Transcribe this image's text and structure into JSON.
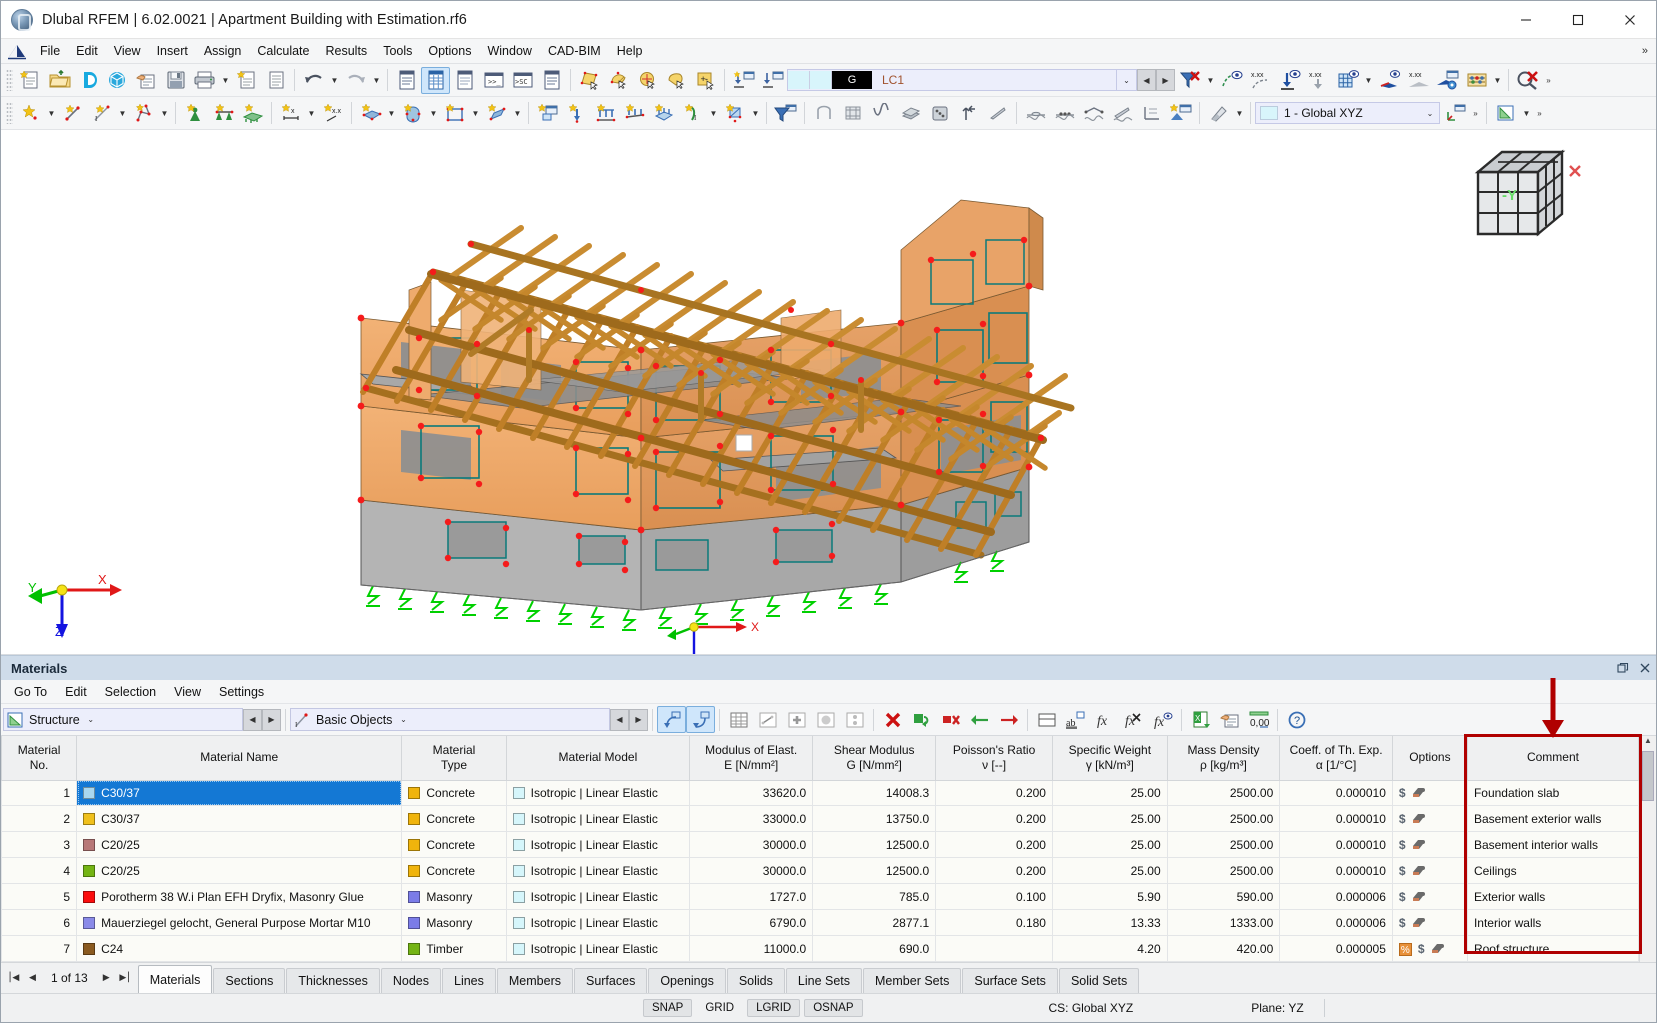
{
  "window": {
    "title": "Dlubal RFEM | 6.02.0021 | Apartment Building with Estimation.rf6",
    "logo_name": "dlubal-rfem-logo",
    "minimize": "–",
    "maximize": "□",
    "close": "✕"
  },
  "menubar": {
    "items": [
      {
        "label": "File"
      },
      {
        "label": "Edit"
      },
      {
        "label": "View"
      },
      {
        "label": "Insert"
      },
      {
        "label": "Assign"
      },
      {
        "label": "Calculate"
      },
      {
        "label": "Results"
      },
      {
        "label": "Tools"
      },
      {
        "label": "Options"
      },
      {
        "label": "Window"
      },
      {
        "label": "CAD-BIM"
      },
      {
        "label": "Help"
      }
    ],
    "overflow": "»"
  },
  "toolbar1": {
    "groups": [
      {
        "buttons": [
          {
            "name": "new-model-icon",
            "glyph": "doc-star"
          },
          {
            "name": "open-folder-icon",
            "glyph": "folder"
          },
          {
            "name": "dlubal-center-icon",
            "glyph": "d-blue"
          },
          {
            "name": "model-cloud-icon",
            "glyph": "cube-blue"
          },
          {
            "name": "model-info-icon",
            "glyph": "hand-doc"
          },
          {
            "name": "save-icon",
            "glyph": "save"
          },
          {
            "name": "print-icon",
            "glyph": "print",
            "caret": true
          },
          {
            "name": "printout-report-icon",
            "glyph": "doc-star"
          },
          {
            "name": "new-report-icon",
            "glyph": "doc"
          }
        ]
      },
      {
        "buttons": [
          {
            "name": "undo-icon",
            "glyph": "undo",
            "caret": true
          },
          {
            "name": "redo-icon",
            "glyph": "redo",
            "caret": true
          }
        ]
      },
      {
        "buttons": [
          {
            "name": "navigator-icon",
            "glyph": "list-panel"
          },
          {
            "name": "table-panel-icon",
            "glyph": "grid-tbl",
            "active": true
          },
          {
            "name": "data-panel-icon",
            "glyph": "list-panel2"
          },
          {
            "name": "console-icon",
            "glyph": "console"
          },
          {
            "name": "script-console-icon",
            "glyph": "console2"
          },
          {
            "name": "detail-panel-icon",
            "glyph": "list-panel"
          }
        ]
      },
      {
        "buttons": [
          {
            "name": "select-by-rectangle-icon",
            "glyph": "sel-rect"
          },
          {
            "name": "select-special-icon",
            "glyph": "sel-special"
          },
          {
            "name": "select-circle-icon",
            "glyph": "sel-circle"
          },
          {
            "name": "select-polygon-icon",
            "glyph": "sel-poly"
          },
          {
            "name": "select-invert-icon",
            "glyph": "sel-invert"
          }
        ]
      },
      {
        "buttons": [
          {
            "name": "load-case-show-icon",
            "glyph": "lc-show"
          },
          {
            "name": "load-case-apply-icon",
            "glyph": "lc-apply"
          }
        ]
      }
    ],
    "load_case": {
      "group_tag": "G",
      "name": "LC1",
      "dropdown_arrow": "⌄",
      "prev": "◀",
      "next": "▶"
    },
    "right_buttons": [
      {
        "name": "filter-clear-icon",
        "glyph": "filter-x",
        "caret": true
      },
      {
        "name": "show-deformation-icon",
        "glyph": "deform-eye"
      },
      {
        "name": "deformation-value-icon",
        "glyph": "xxx-deform"
      },
      {
        "name": "show-supports-icon",
        "glyph": "support-eye"
      },
      {
        "name": "support-value-icon",
        "glyph": "xxx-support"
      },
      {
        "name": "show-grid-icon",
        "glyph": "grid-eye",
        "caret": true
      },
      {
        "name": "show-diagram-icon",
        "glyph": "diagram-eye"
      },
      {
        "name": "diagram-value-icon",
        "glyph": "xxx-diagram"
      },
      {
        "name": "result-settings-icon",
        "glyph": "diagram-gear"
      },
      {
        "name": "calculation-icon",
        "glyph": "abacus",
        "caret": true
      }
    ],
    "far_right": [
      {
        "name": "clear-results-icon",
        "glyph": "magnifier-x"
      }
    ],
    "overflow": "»"
  },
  "toolbar2": {
    "groups": [
      {
        "buttons": [
          {
            "name": "new-node-icon",
            "glyph": "star-node",
            "caret": true
          },
          {
            "name": "new-line-icon",
            "glyph": "star-line"
          },
          {
            "name": "new-line-dim-icon",
            "glyph": "star-line2",
            "caret": true
          },
          {
            "name": "new-polyline-icon",
            "glyph": "star-poly",
            "caret": true
          }
        ]
      },
      {
        "buttons": [
          {
            "name": "new-support-icon",
            "glyph": "star-support"
          },
          {
            "name": "new-line-support-icon",
            "glyph": "star-lsupport"
          },
          {
            "name": "new-surface-support-icon",
            "glyph": "star-ssupport"
          }
        ]
      },
      {
        "buttons": [
          {
            "name": "new-dimension-x-icon",
            "glyph": "star-dimx",
            "caret": true
          },
          {
            "name": "new-dimension-xx-icon",
            "glyph": "star-dimxx"
          }
        ]
      },
      {
        "buttons": [
          {
            "name": "new-surface-icon",
            "glyph": "star-surface",
            "caret": true
          },
          {
            "name": "new-solid-icon",
            "glyph": "star-solid",
            "caret": true
          },
          {
            "name": "new-opening-icon",
            "glyph": "star-opening",
            "caret": true
          },
          {
            "name": "new-member-icon",
            "glyph": "star-member",
            "caret": true
          }
        ]
      },
      {
        "buttons": [
          {
            "name": "new-load-icon",
            "glyph": "star-load"
          },
          {
            "name": "new-nodal-load-icon",
            "glyph": "star-nload"
          },
          {
            "name": "new-line-load-icon",
            "glyph": "star-lload"
          },
          {
            "name": "new-member-load-icon",
            "glyph": "star-mload"
          },
          {
            "name": "new-surface-load-icon",
            "glyph": "star-sload"
          },
          {
            "name": "new-free-load-icon",
            "glyph": "star-fload",
            "caret": true
          },
          {
            "name": "new-imperfection-icon",
            "glyph": "star-imp",
            "caret": true
          }
        ]
      },
      {
        "buttons": [
          {
            "name": "visibility-icon",
            "glyph": "funnel-blue"
          }
        ]
      },
      {
        "buttons": [
          {
            "name": "render-wireframe-icon",
            "glyph": "wire"
          },
          {
            "name": "render-filled-icon",
            "glyph": "filmstrip"
          },
          {
            "name": "render-smooth-icon",
            "glyph": "curve"
          },
          {
            "name": "render-surface-icon",
            "glyph": "plate"
          },
          {
            "name": "render-solid-icon",
            "glyph": "dice"
          },
          {
            "name": "render-transparent-icon",
            "glyph": "arrows-up"
          },
          {
            "name": "render-line-icon",
            "glyph": "slash"
          }
        ]
      },
      {
        "buttons": [
          {
            "name": "hinge-display-icon",
            "glyph": "hinge1"
          },
          {
            "name": "hinge-display2-icon",
            "glyph": "hinge2"
          },
          {
            "name": "hinge-display3-icon",
            "glyph": "hinge3"
          },
          {
            "name": "hinge-display4-icon",
            "glyph": "hinge4"
          },
          {
            "name": "hinge-display5-icon",
            "glyph": "hinge5"
          },
          {
            "name": "new-view-icon",
            "glyph": "star-view"
          }
        ]
      },
      {
        "buttons": [
          {
            "name": "work-plane-icon",
            "glyph": "plane-grey",
            "caret": true
          }
        ]
      }
    ],
    "coordinate_system": {
      "value": "1 - Global XYZ",
      "arrow": "⌄"
    },
    "cs_extra": [
      {
        "name": "cs-settings-icon",
        "glyph": "cs-gear"
      }
    ],
    "overflow": "»",
    "right_buttons": [
      {
        "name": "section-properties-icon",
        "glyph": "green-table",
        "caret": true
      }
    ]
  },
  "viewport": {
    "navcube_label": "-Y",
    "axes": {
      "x": "X",
      "y": "Y",
      "z": "Z"
    }
  },
  "panel": {
    "title": "Materials",
    "window_controls": {
      "restore": "❐",
      "close": "✕"
    },
    "menu": [
      {
        "label": "Go To"
      },
      {
        "label": "Edit"
      },
      {
        "label": "Selection"
      },
      {
        "label": "View"
      },
      {
        "label": "Settings"
      }
    ],
    "combo_structure": {
      "value": "Structure",
      "arrow": "⌄",
      "prev": "◀",
      "next": "▶"
    },
    "combo_objects": {
      "value": "Basic Objects",
      "arrow": "⌄",
      "prev": "◀",
      "next": "▶"
    },
    "toolbar_buttons": [
      {
        "name": "select-in-model-icon",
        "glyph": "arrow-up-box",
        "active": true
      },
      {
        "name": "select-in-table-icon",
        "glyph": "arrow-down-box",
        "active": true
      },
      {
        "name": "table-view-all-icon",
        "glyph": "tbl1"
      },
      {
        "name": "table-view-members-icon",
        "glyph": "tbl2"
      },
      {
        "name": "table-view-nodes-icon",
        "glyph": "tbl3"
      },
      {
        "name": "table-view-surfaces-icon",
        "glyph": "tbl4"
      },
      {
        "name": "table-view-solids-icon",
        "glyph": "tbl5"
      },
      {
        "name": "delete-row-icon",
        "glyph": "red-x"
      },
      {
        "name": "insert-row-icon",
        "glyph": "green-insert"
      },
      {
        "name": "delete-content-icon",
        "glyph": "red-delete"
      },
      {
        "name": "move-left-icon",
        "glyph": "green-left"
      },
      {
        "name": "move-right-icon",
        "glyph": "red-right"
      },
      {
        "name": "table-layout-icon",
        "glyph": "tbl-layout"
      },
      {
        "name": "rename-icon",
        "glyph": "ab-equals"
      },
      {
        "name": "formula-icon",
        "glyph": "fx"
      },
      {
        "name": "delete-formula-icon",
        "glyph": "fx-x"
      },
      {
        "name": "show-formula-icon",
        "glyph": "fx-eye"
      },
      {
        "name": "export-excel-icon",
        "glyph": "excel"
      },
      {
        "name": "print-table-icon",
        "glyph": "print-hand"
      },
      {
        "name": "decimal-places-icon",
        "glyph": "zero-comma"
      },
      {
        "name": "table-help-icon",
        "glyph": "question"
      }
    ]
  },
  "table": {
    "columns": [
      {
        "id": "no",
        "header": "Material",
        "subheader": "No."
      },
      {
        "id": "name",
        "header": "Material Name",
        "subheader": ""
      },
      {
        "id": "type",
        "header": "Material",
        "subheader": "Type"
      },
      {
        "id": "model",
        "header": "Material Model",
        "subheader": ""
      },
      {
        "id": "emod",
        "header": "Modulus of Elast.",
        "subheader": "E [N/mm²]"
      },
      {
        "id": "gmod",
        "header": "Shear Modulus",
        "subheader": "G [N/mm²]"
      },
      {
        "id": "poisson",
        "header": "Poisson's Ratio",
        "subheader": "ν [--]"
      },
      {
        "id": "weight",
        "header": "Specific Weight",
        "subheader": "γ [kN/m³]"
      },
      {
        "id": "density",
        "header": "Mass Density",
        "subheader": "ρ [kg/m³]"
      },
      {
        "id": "alpha",
        "header": "Coeff. of Th. Exp.",
        "subheader": "α [1/°C]"
      },
      {
        "id": "options",
        "header": "Options",
        "subheader": ""
      },
      {
        "id": "comment",
        "header": "Comment",
        "subheader": ""
      }
    ],
    "rows": [
      {
        "no": "1",
        "color": "#a9d7ef",
        "name": "C30/37",
        "type_color": "#f0b40c",
        "type": "Concrete",
        "model_color": "#d6f6fb",
        "model": "Isotropic | Linear Elastic",
        "emod": "33620.0",
        "gmod": "14008.3",
        "poisson": "0.200",
        "weight": "25.00",
        "density": "2500.00",
        "alpha": "0.000010",
        "options": [
          "dollar",
          "eraser"
        ],
        "comment": "Foundation slab",
        "selected": true
      },
      {
        "no": "2",
        "color": "#f0c01c",
        "name": "C30/37",
        "type_color": "#f0b40c",
        "type": "Concrete",
        "model_color": "#d6f6fb",
        "model": "Isotropic | Linear Elastic",
        "emod": "33000.0",
        "gmod": "13750.0",
        "poisson": "0.200",
        "weight": "25.00",
        "density": "2500.00",
        "alpha": "0.000010",
        "options": [
          "dollar",
          "eraser"
        ],
        "comment": "Basement exterior walls",
        "selected": false
      },
      {
        "no": "3",
        "color": "#b87878",
        "name": "C20/25",
        "type_color": "#f0b40c",
        "type": "Concrete",
        "model_color": "#d6f6fb",
        "model": "Isotropic | Linear Elastic",
        "emod": "30000.0",
        "gmod": "12500.0",
        "poisson": "0.200",
        "weight": "25.00",
        "density": "2500.00",
        "alpha": "0.000010",
        "options": [
          "dollar",
          "eraser"
        ],
        "comment": "Basement interior walls",
        "selected": false
      },
      {
        "no": "4",
        "color": "#74b414",
        "name": "C20/25",
        "type_color": "#f0b40c",
        "type": "Concrete",
        "model_color": "#d6f6fb",
        "model": "Isotropic | Linear Elastic",
        "emod": "30000.0",
        "gmod": "12500.0",
        "poisson": "0.200",
        "weight": "25.00",
        "density": "2500.00",
        "alpha": "0.000010",
        "options": [
          "dollar",
          "eraser"
        ],
        "comment": "Ceilings",
        "selected": false
      },
      {
        "no": "5",
        "color": "#fb0d0d",
        "name": "Porotherm 38 W.i Plan EFH Dryfix, Masonry Glue",
        "type_color": "#7b7ce8",
        "type": "Masonry",
        "model_color": "#d6f6fb",
        "model": "Isotropic | Linear Elastic",
        "emod": "1727.0",
        "gmod": "785.0",
        "poisson": "0.100",
        "weight": "5.90",
        "density": "590.00",
        "alpha": "0.000006",
        "options": [
          "dollar",
          "eraser"
        ],
        "comment": "Exterior walls",
        "selected": false
      },
      {
        "no": "6",
        "color": "#8a8ae8",
        "name": "Mauerziegel gelocht, General Purpose Mortar M10",
        "type_color": "#7b7ce8",
        "type": "Masonry",
        "model_color": "#d6f6fb",
        "model": "Isotropic | Linear Elastic",
        "emod": "6790.0",
        "gmod": "2877.1",
        "poisson": "0.180",
        "weight": "13.33",
        "density": "1333.00",
        "alpha": "0.000006",
        "options": [
          "dollar",
          "eraser"
        ],
        "comment": "Interior walls",
        "selected": false
      },
      {
        "no": "7",
        "color": "#8a5a20",
        "name": "C24",
        "type_color": "#74b414",
        "type": "Timber",
        "model_color": "#d6f6fb",
        "model": "Isotropic | Linear Elastic",
        "emod": "11000.0",
        "gmod": "690.0",
        "poisson": "",
        "weight": "4.20",
        "density": "420.00",
        "alpha": "0.000005",
        "options": [
          "percent",
          "dollar",
          "eraser"
        ],
        "comment": "Roof structure",
        "selected": false
      }
    ],
    "annotation": {
      "highlight_color": "#b00000",
      "target_column": "Comment"
    }
  },
  "tabs": {
    "pager": {
      "first": "⎮◀",
      "prev": "◀",
      "count": "1 of 13",
      "next": "▶",
      "last": "▶⎮"
    },
    "items": [
      {
        "label": "Materials",
        "active": true
      },
      {
        "label": "Sections",
        "active": false
      },
      {
        "label": "Thicknesses",
        "active": false
      },
      {
        "label": "Nodes",
        "active": false
      },
      {
        "label": "Lines",
        "active": false
      },
      {
        "label": "Members",
        "active": false
      },
      {
        "label": "Surfaces",
        "active": false
      },
      {
        "label": "Openings",
        "active": false
      },
      {
        "label": "Solids",
        "active": false
      },
      {
        "label": "Line Sets",
        "active": false
      },
      {
        "label": "Member Sets",
        "active": false
      },
      {
        "label": "Surface Sets",
        "active": false
      },
      {
        "label": "Solid Sets",
        "active": false
      }
    ]
  },
  "statusbar": {
    "toggles": [
      {
        "label": "SNAP",
        "on": true
      },
      {
        "label": "GRID",
        "on": false
      },
      {
        "label": "LGRID",
        "on": true
      },
      {
        "label": "OSNAP",
        "on": true
      }
    ],
    "coordinate_system": "CS: Global XYZ",
    "plane": "Plane: YZ"
  }
}
